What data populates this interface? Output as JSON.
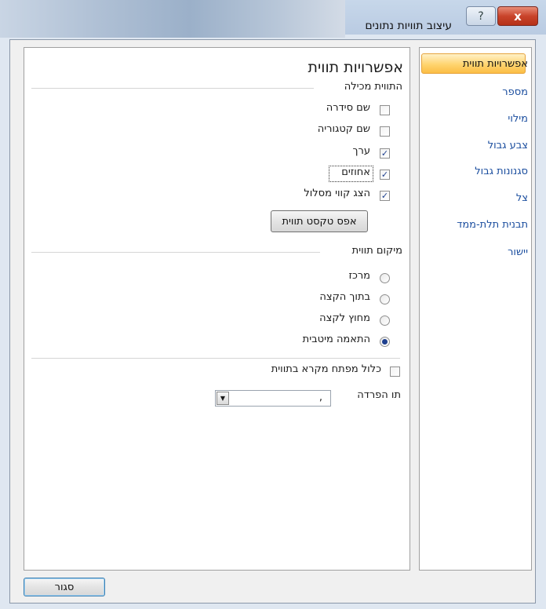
{
  "window": {
    "title": "עיצוב תוויות נתונים",
    "help_icon": "?",
    "close_icon": "x"
  },
  "categories": [
    {
      "label": "אפשרויות תווית",
      "selected": true
    },
    {
      "label": "מספר"
    },
    {
      "label": "מילוי"
    },
    {
      "label": "צבע גבול"
    },
    {
      "label": "סגנונות גבול"
    },
    {
      "label": "צל"
    },
    {
      "label": "תבנית תלת-ממד"
    },
    {
      "label": "יישור"
    }
  ],
  "main": {
    "heading": "אפשרויות תווית",
    "contains_section": "התווית מכילה",
    "checkboxes": [
      {
        "label": "שם סידרה",
        "checked": false
      },
      {
        "label": "שם קטגוריה",
        "checked": false
      },
      {
        "label": "ערך",
        "checked": true
      },
      {
        "label": "אחוזים",
        "checked": true
      },
      {
        "label": "הצג קווי מסלול",
        "checked": true
      }
    ],
    "reset_button": "אפס טקסט תווית",
    "position_section": "מיקום תווית",
    "radios": [
      {
        "label": "מרכז",
        "selected": false
      },
      {
        "label": "בתוך הקצה",
        "selected": false
      },
      {
        "label": "מחוץ לקצה",
        "selected": false
      },
      {
        "label": "התאמה מיטבית",
        "selected": true
      }
    ],
    "legend_key": {
      "label": "כלול מפתח מקרא בתווית",
      "checked": false
    },
    "separator": {
      "label": "תו הפרדה",
      "value": ","
    }
  },
  "footer": {
    "close_button": "סגור"
  }
}
